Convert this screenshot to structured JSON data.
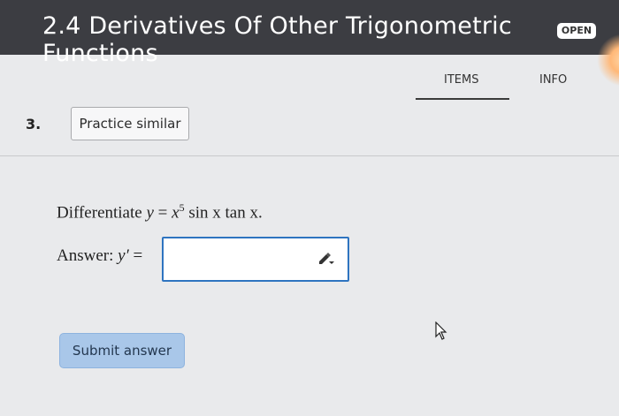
{
  "header": {
    "title": "2.4 Derivatives Of Other Trigonometric Functions",
    "badge": "OPEN"
  },
  "tabs": {
    "items_label": "ITEMS",
    "info_label": "INFO",
    "active": "ITEMS"
  },
  "question": {
    "number": "3.",
    "practice_label": "Practice similar",
    "prompt_prefix": "Differentiate ",
    "equation_lhs": "y",
    "equals": " = ",
    "equation_base": "x",
    "equation_exp": "5",
    "equation_rest": " sin x tan x.",
    "answer_label": "Answer: ",
    "answer_var": "y′",
    "answer_equals": " =",
    "answer_value": ""
  },
  "actions": {
    "submit_label": "Submit answer"
  },
  "icons": {
    "editor": "pencil-dropdown-icon",
    "cursor": "mouse-pointer-icon"
  }
}
